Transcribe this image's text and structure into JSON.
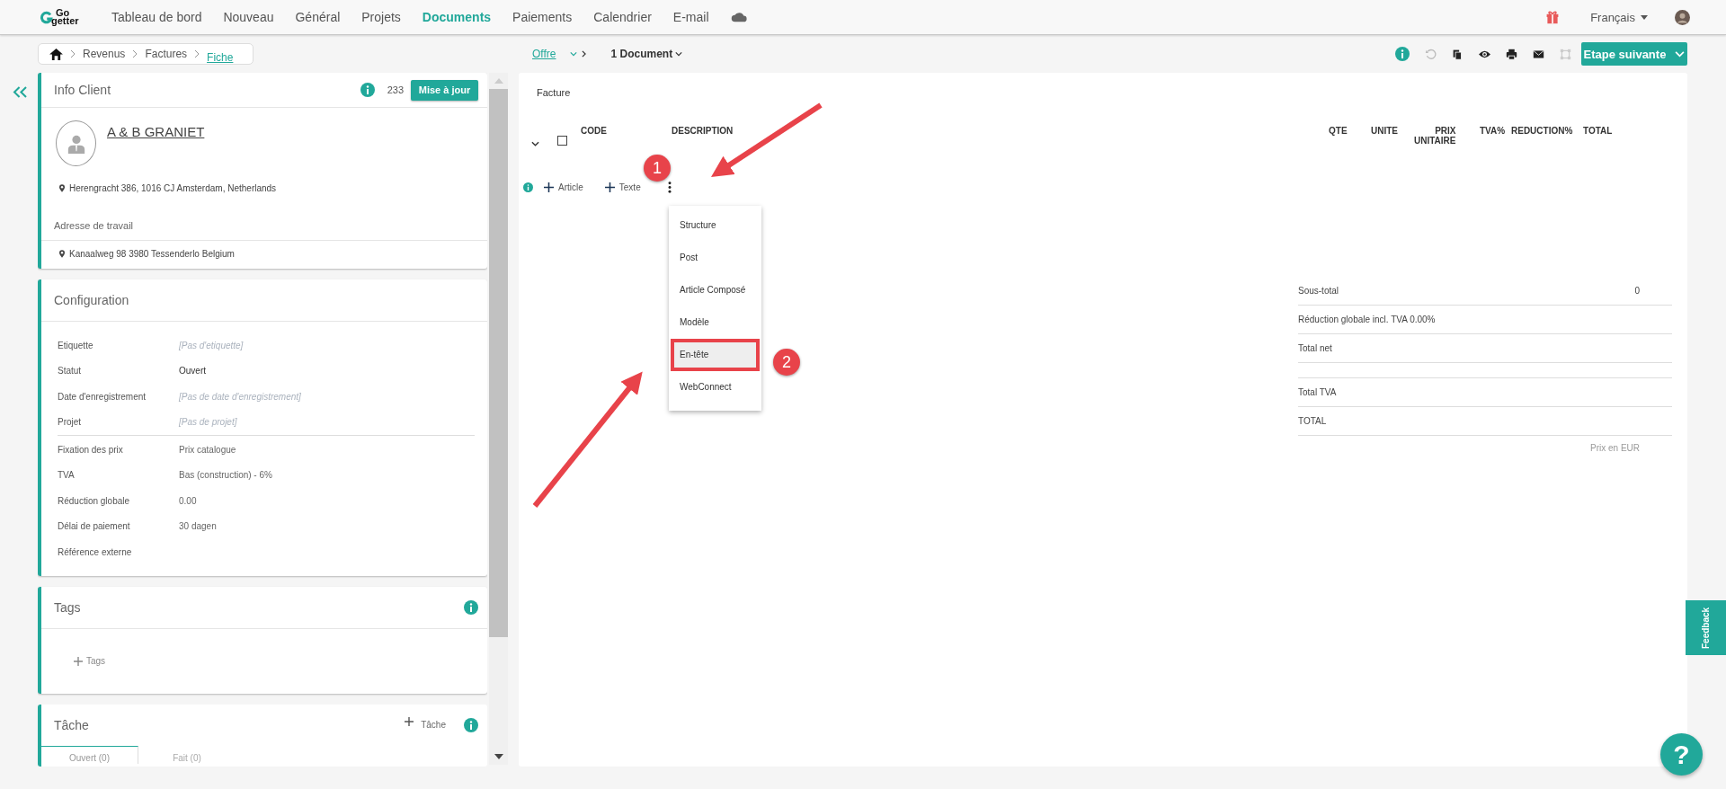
{
  "nav": {
    "logo_top": "Go",
    "logo_bottom": "getter",
    "items": [
      {
        "label": "Tableau de bord",
        "selected": false
      },
      {
        "label": "Nouveau",
        "selected": false
      },
      {
        "label": "Général",
        "selected": false
      },
      {
        "label": "Projets",
        "selected": false
      },
      {
        "label": "Documents",
        "selected": true
      },
      {
        "label": "Paiements",
        "selected": false
      },
      {
        "label": "Calendrier",
        "selected": false
      },
      {
        "label": "E-mail",
        "selected": false
      }
    ],
    "language": "Français"
  },
  "breadcrumb": [
    {
      "label": "Revenus",
      "current": false
    },
    {
      "label": "Factures",
      "current": false
    },
    {
      "label": "Fiche",
      "current": true
    }
  ],
  "document_bar": {
    "stage": "Offre",
    "documents": "1 Document"
  },
  "toolbar": {
    "next_step": "Etape suivante"
  },
  "client": {
    "title": "Info Client",
    "count": "233",
    "update": "Mise à jour",
    "name": "A & B GRANIET",
    "address": "Herengracht 386, 1016 CJ Amsterdam, Netherlands",
    "work_address_label": "Adresse de travail",
    "work_address": "Kanaalweg 98 3980 Tessenderlo Belgium"
  },
  "configuration": {
    "title": "Configuration",
    "groups": [
      [
        {
          "label": "Etiquette",
          "placeholder": "[Pas d'etiquette]"
        },
        {
          "label": "Statut",
          "value": "Ouvert"
        },
        {
          "label": "Date d'enregistrement",
          "placeholder": "[Pas de date d'enregistrement]"
        },
        {
          "label": "Projet",
          "placeholder": "[Pas de projet]"
        }
      ],
      [
        {
          "label": "Fixation des prix",
          "value": "Prix catalogue"
        },
        {
          "label": "TVA",
          "value": "Bas (construction) - 6%"
        },
        {
          "label": "Réduction globale",
          "value": "0.00"
        },
        {
          "label": "Délai de paiement",
          "value": "30 dagen"
        },
        {
          "label": "Référence externe"
        }
      ]
    ]
  },
  "tags": {
    "title": "Tags",
    "add": "Tags"
  },
  "task": {
    "title": "Tâche",
    "add": "Tâche",
    "tabs": [
      {
        "label": "Ouvert (0)",
        "selected": true
      },
      {
        "label": "Fait (0)",
        "selected": false
      }
    ]
  },
  "document": {
    "title": "Facture",
    "columns": [
      "CODE",
      "DESCRIPTION",
      "QTE",
      "UNITE",
      "PRIX UNITAIRE",
      "TVA%",
      "REDUCTION%",
      "TOTAL"
    ],
    "select_all": {
      "checked": false
    },
    "actions": [
      "Article",
      "Texte"
    ],
    "menu": [
      {
        "label": "Structure",
        "highlighted": false
      },
      {
        "label": "Post",
        "highlighted": false
      },
      {
        "label": "Article Composé",
        "highlighted": false
      },
      {
        "label": "Modèle",
        "highlighted": false
      },
      {
        "label": "En-tête",
        "highlighted": true
      },
      {
        "label": "WebConnect",
        "highlighted": false
      }
    ],
    "totals": [
      [
        {
          "label": "Sous-total",
          "value": "0"
        },
        {
          "label": "Réduction globale incl. TVA 0.00%"
        },
        {
          "label": "Total net"
        }
      ],
      [
        {
          "label": "Total TVA"
        },
        {
          "label": "TOTAL"
        }
      ]
    ],
    "currency_note": "Prix en EUR"
  },
  "annotations": [
    {
      "number": "1"
    },
    {
      "number": "2"
    }
  ],
  "feedback": "Feedback",
  "help": "?"
}
